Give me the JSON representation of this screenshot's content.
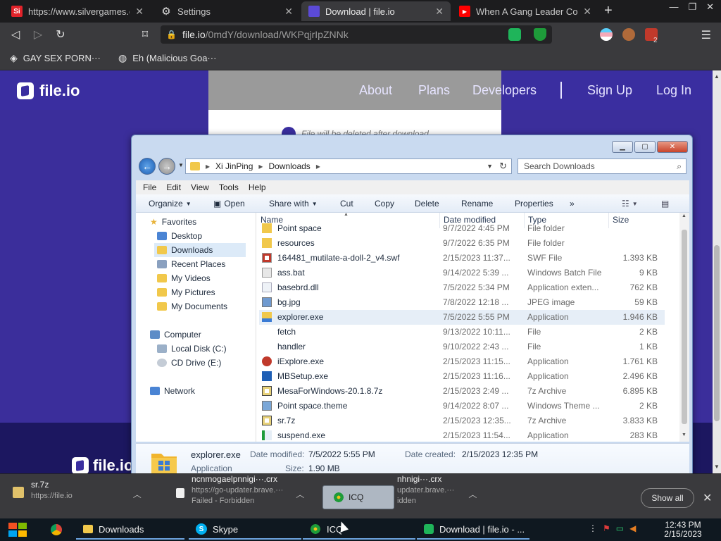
{
  "browser": {
    "tabs": [
      {
        "title": "https://www.silvergames.cc",
        "favicon": "Si",
        "favicon_color": "#e2232a"
      },
      {
        "title": "Settings",
        "favicon": "gear-icon"
      },
      {
        "title": "Download | file.io",
        "favicon": "file.io",
        "active": true
      },
      {
        "title": "When A Gang Leader Conf",
        "favicon": "youtube-icon",
        "favicon_color": "#ff0000"
      }
    ],
    "url_host": "file.io",
    "url_path": "/0mdY/download/WKPqjrIpZNNk",
    "extension_badge": "2",
    "bookmarks": [
      {
        "label": "GAY SEX PORN···"
      },
      {
        "label": "Eh (Malicious Goa···"
      }
    ]
  },
  "site": {
    "logo": "file.io",
    "nav": [
      "About",
      "Plans",
      "Developers",
      "Sign Up",
      "Log In"
    ],
    "note": "File will be deleted after download",
    "accent": "#3a2ea0"
  },
  "explorer": {
    "breadcrumb": [
      "Xi JinPing",
      "Downloads"
    ],
    "search_placeholder": "Search Downloads",
    "menu": [
      "File",
      "Edit",
      "View",
      "Tools",
      "Help"
    ],
    "commands": [
      "Organize",
      "Open",
      "Share with",
      "Cut",
      "Copy",
      "Delete",
      "Rename",
      "Properties",
      "»"
    ],
    "nav_pane": {
      "favorites_label": "Favorites",
      "favorites": [
        "Desktop",
        "Downloads",
        "Recent Places",
        "My Videos",
        "My Pictures",
        "My Documents"
      ],
      "computer_label": "Computer",
      "drives": [
        "Local Disk (C:)",
        "CD Drive (E:)"
      ],
      "network_label": "Network"
    },
    "columns": [
      "Name",
      "Date modified",
      "Type",
      "Size"
    ],
    "files": [
      {
        "name": "Point space",
        "date": "9/7/2022 4:45 PM",
        "type": "File folder",
        "size": "",
        "icon": "folder"
      },
      {
        "name": "resources",
        "date": "9/7/2022 6:35 PM",
        "type": "File folder",
        "size": "",
        "icon": "folder"
      },
      {
        "name": "164481_mutilate-a-doll-2_v4.swf",
        "date": "2/15/2023 11:37...",
        "type": "SWF File",
        "size": "1.393 KB",
        "icon": "swf"
      },
      {
        "name": "ass.bat",
        "date": "9/14/2022 5:39 ...",
        "type": "Windows Batch File",
        "size": "9 KB",
        "icon": "bat"
      },
      {
        "name": "basebrd.dll",
        "date": "7/5/2022 5:34 PM",
        "type": "Application exten...",
        "size": "762 KB",
        "icon": "dll"
      },
      {
        "name": "bg.jpg",
        "date": "7/8/2022 12:18 ...",
        "type": "JPEG image",
        "size": "59 KB",
        "icon": "image"
      },
      {
        "name": "explorer.exe",
        "date": "7/5/2022 5:55 PM",
        "type": "Application",
        "size": "1.946 KB",
        "icon": "explorer",
        "selected": true
      },
      {
        "name": "fetch",
        "date": "9/13/2022 10:11...",
        "type": "File",
        "size": "2 KB",
        "icon": "blank"
      },
      {
        "name": "handler",
        "date": "9/10/2022 2:43 ...",
        "type": "File",
        "size": "1 KB",
        "icon": "blank"
      },
      {
        "name": "iExplore.exe",
        "date": "2/15/2023 11:15...",
        "type": "Application",
        "size": "1.761 KB",
        "icon": "ie"
      },
      {
        "name": "MBSetup.exe",
        "date": "2/15/2023 11:16...",
        "type": "Application",
        "size": "2.496 KB",
        "icon": "mb"
      },
      {
        "name": "MesaForWindows-20.1.8.7z",
        "date": "2/15/2023 2:49 ...",
        "type": "7z Archive",
        "size": "6.895 KB",
        "icon": "7z"
      },
      {
        "name": "Point space.theme",
        "date": "9/14/2022 8:07 ...",
        "type": "Windows Theme ...",
        "size": "2 KB",
        "icon": "theme"
      },
      {
        "name": "sr.7z",
        "date": "2/15/2023 12:35...",
        "type": "7z Archive",
        "size": "3.833 KB",
        "icon": "7z"
      },
      {
        "name": "suspend.exe",
        "date": "2/15/2023 11:54...",
        "type": "Application",
        "size": "283 KB",
        "icon": "exe"
      }
    ],
    "details": {
      "name": "explorer.exe",
      "kind": "Application",
      "modified_label": "Date modified:",
      "modified": "7/5/2022 5:55 PM",
      "created_label": "Date created:",
      "created": "2/15/2023 12:35 PM",
      "size_label": "Size:",
      "size": "1.90 MB"
    }
  },
  "downloads": [
    {
      "name": "sr.7z",
      "sub": "https://file.io"
    },
    {
      "name": "ncnmogaelpnnigi···.crx",
      "sub": "https://go-updater.brave.···",
      "status": "Failed - Forbidden"
    },
    {
      "name": "nhnigi···.crx",
      "sub": "updater.brave.···",
      "status": "idden"
    }
  ],
  "icq_label": "ICQ",
  "show_all": "Show all",
  "taskbar": {
    "items": [
      "Downloads",
      "Skype",
      "ICQ",
      "Download | file.io - ..."
    ],
    "time": "12:43 PM",
    "date": "2/15/2023"
  }
}
